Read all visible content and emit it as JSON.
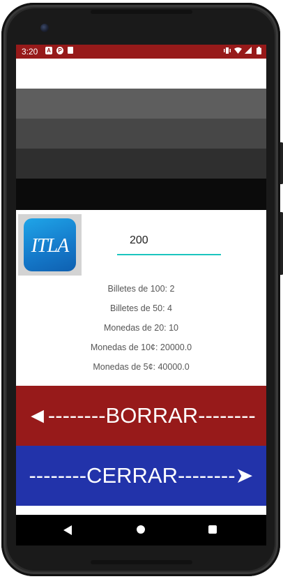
{
  "status_bar": {
    "time": "3:20",
    "left_icons": [
      "A",
      "P",
      "sd-card"
    ],
    "right_icons": [
      "vibrate-icon",
      "wifi-icon",
      "signal-icon",
      "battery-icon"
    ]
  },
  "logo": {
    "text": "ITLA"
  },
  "amount_input": {
    "value": "200"
  },
  "results": [
    "Billetes de 100: 2",
    "Billetes de 50: 4",
    "Monedas de 20: 10",
    "Monedas de 10¢: 20000.0",
    "Monedas de 5¢: 40000.0"
  ],
  "buttons": {
    "borrar": "◄--------BORRAR--------",
    "cerrar": "--------CERRAR--------➤"
  },
  "colors": {
    "status_bar": "#971a1a",
    "borrar_bg": "#971a1a",
    "cerrar_bg": "#2233aa",
    "input_underline": "#1cc5bf"
  }
}
